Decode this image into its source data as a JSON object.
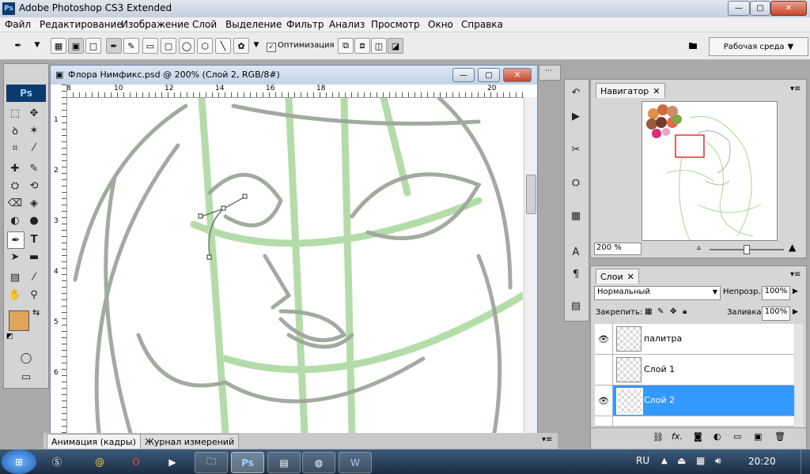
{
  "window": {
    "app_icon": "Ps",
    "title": "Adobe Photoshop CS3 Extended",
    "minimize": "—",
    "maximize": "▢",
    "close": "✕"
  },
  "menu": [
    "Файл",
    "Редактирование",
    "Изображение",
    "Слой",
    "Выделение",
    "Фильтр",
    "Анализ",
    "Просмотр",
    "Окно",
    "Справка"
  ],
  "options_bar": {
    "auto_optimize_label": "Оптимизация",
    "auto_optimize_checked": true,
    "workspace_label": "Рабочая среда"
  },
  "toolbox": {
    "logo": "Ps",
    "foreground_color": "#e1a55a",
    "background_color": "#ffe0b4"
  },
  "document": {
    "title": "Флора Нимфикс.psd @ 200% (Слой 2, RGB/8#)",
    "ruler_top": [
      "8",
      "10",
      "12",
      "14",
      "16",
      "18",
      "20"
    ],
    "ruler_left": [
      "1",
      "2",
      "3",
      "4",
      "5",
      "6"
    ]
  },
  "navigator": {
    "tab": "Навигатор",
    "zoom": "200 %"
  },
  "layers": {
    "tab": "Слои",
    "blend_mode": "Нормальный",
    "opacity_label": "Непрозр.:",
    "opacity": "100%",
    "lock_label": "Закрепить:",
    "fill_label": "Заливка:",
    "fill": "100%",
    "items": [
      {
        "name": "палитра",
        "visible": true,
        "selected": false
      },
      {
        "name": "Слой 1",
        "visible": false,
        "selected": false
      },
      {
        "name": "Слой 2",
        "visible": true,
        "selected": true
      }
    ],
    "footer_fx": "fx."
  },
  "bottom_tabs": [
    "Анимация (кадры)",
    "Журнал измерений"
  ],
  "taskbar": {
    "lang": "RU",
    "time": "20:20"
  }
}
